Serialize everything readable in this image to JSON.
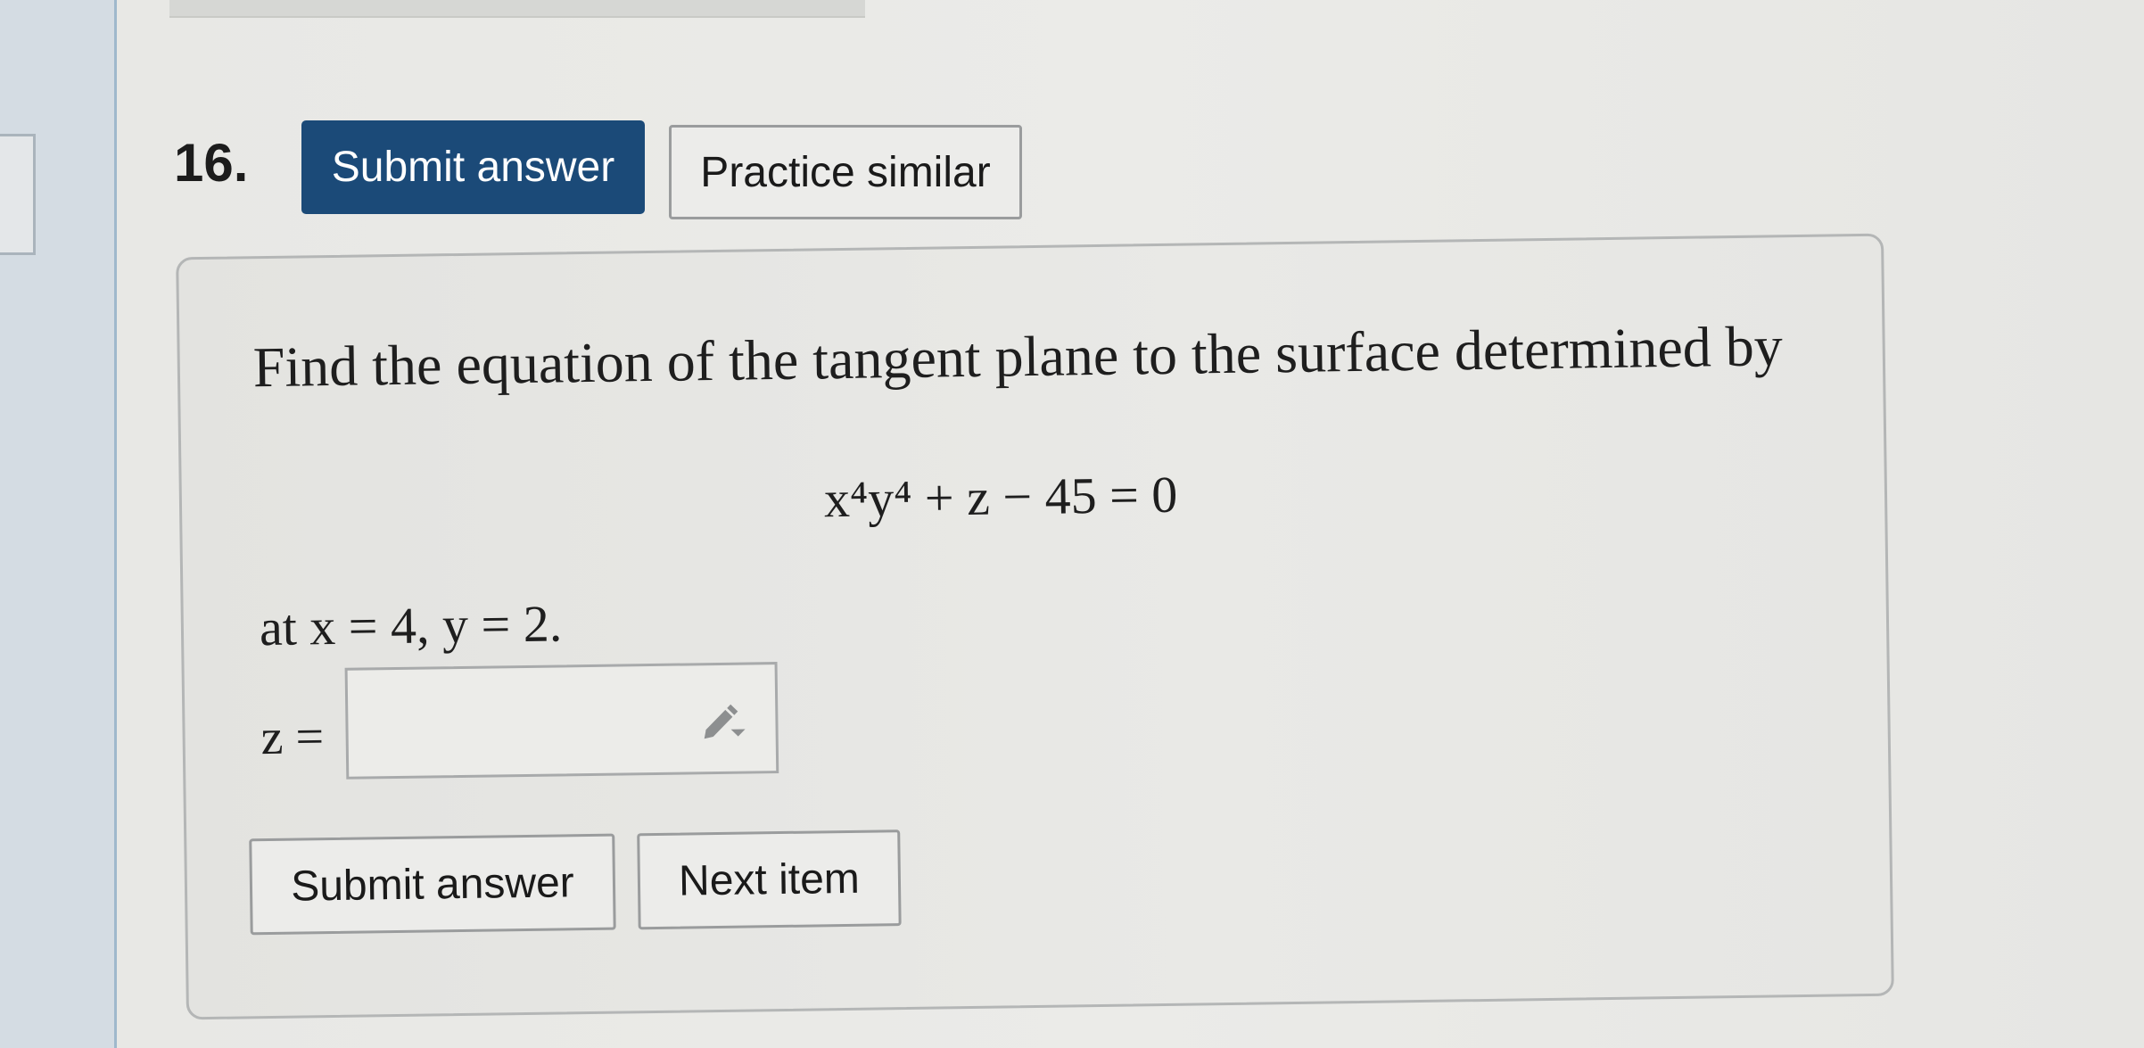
{
  "question": {
    "number": "16."
  },
  "header_buttons": {
    "submit_label": "Submit answer",
    "practice_label": "Practice similar"
  },
  "problem": {
    "prompt": "Find the equation of the tangent plane to the surface determined by",
    "equation": "x⁴y⁴ + z − 45 = 0",
    "condition": "at x = 4, y = 2.",
    "answer_label": "z ="
  },
  "answer_field": {
    "value": "",
    "placeholder": "",
    "icon": "pencil-icon"
  },
  "footer_buttons": {
    "submit_label": "Submit answer",
    "next_label": "Next item"
  },
  "colors": {
    "primary_button": "#1b4a78",
    "background": "#e8e8e5",
    "border": "#9a9c9d"
  }
}
